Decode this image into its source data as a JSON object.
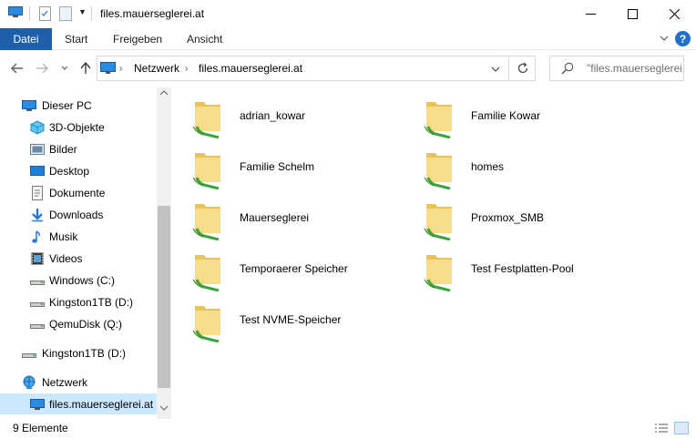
{
  "window": {
    "title": "files.mauerseglerei.at",
    "minimize_glyph": "—",
    "maximize_glyph": "☐",
    "close_glyph": "✕"
  },
  "ribbon": {
    "file_tab": "Datei",
    "tabs": [
      "Start",
      "Freigeben",
      "Ansicht"
    ],
    "help_glyph": "?"
  },
  "address": {
    "crumbs": [
      "Netzwerk",
      "files.mauerseglerei.at"
    ],
    "separator": "›"
  },
  "search": {
    "placeholder": "\"files.mauerseglerei.at\" durchsuchen"
  },
  "sidebar": {
    "items": [
      {
        "label": "Dieser PC",
        "icon": "pc-icon"
      },
      {
        "label": "3D-Objekte",
        "icon": "3d-objects-icon"
      },
      {
        "label": "Bilder",
        "icon": "pictures-icon"
      },
      {
        "label": "Desktop",
        "icon": "desktop-icon"
      },
      {
        "label": "Dokumente",
        "icon": "documents-icon"
      },
      {
        "label": "Downloads",
        "icon": "downloads-icon"
      },
      {
        "label": "Musik",
        "icon": "music-icon"
      },
      {
        "label": "Videos",
        "icon": "videos-icon"
      },
      {
        "label": "Windows (C:)",
        "icon": "drive-icon"
      },
      {
        "label": "Kingston1TB (D:)",
        "icon": "drive-icon"
      },
      {
        "label": "QemuDisk (Q:)",
        "icon": "drive-icon"
      },
      {
        "label": "Kingston1TB (D:)",
        "icon": "drive-icon"
      },
      {
        "label": "Netzwerk",
        "icon": "network-icon"
      },
      {
        "label": "files.mauerseglerei.at",
        "icon": "pc-icon",
        "selected": true
      }
    ]
  },
  "content": {
    "items": [
      "adrian_kowar",
      "Familie Kowar",
      "Familie Schelm",
      "homes",
      "Mauerseglerei",
      "Proxmox_SMB",
      "Temporaerer Speicher",
      "Test Festplatten-Pool",
      "Test NVME-Speicher"
    ]
  },
  "status": {
    "count": "9 Elemente"
  },
  "colors": {
    "accent": "#1d5fa8",
    "selection": "#cce8ff",
    "folder": "#f3d27a"
  }
}
